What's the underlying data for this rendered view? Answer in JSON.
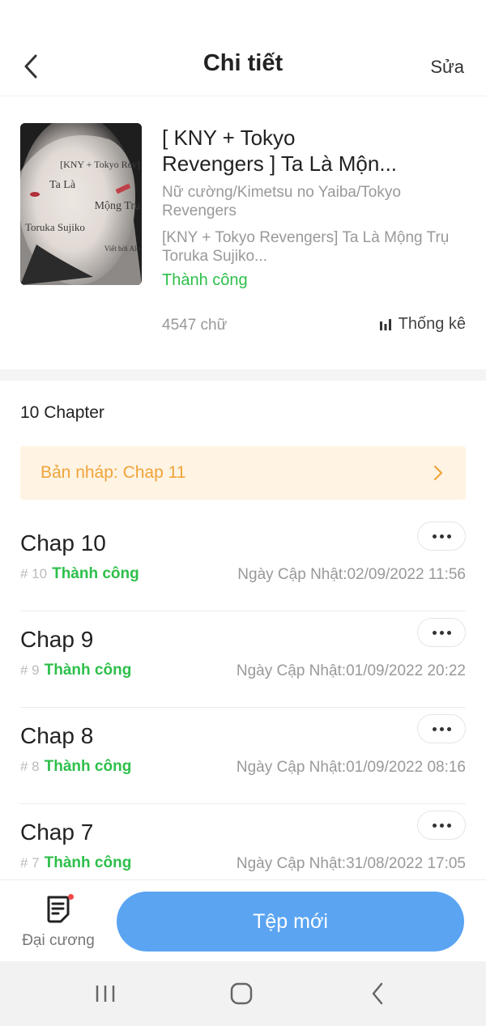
{
  "header": {
    "title": "Chi tiết",
    "edit_label": "Sửa"
  },
  "book": {
    "title_line1": "[ KNY + Tokyo",
    "title_line2": "Revengers ] Ta Là Mộn...",
    "tags": "Nữ cường/Kimetsu no Yaiba/Tokyo Revengers",
    "desc_line1": "[KNY + Tokyo Revengers] Ta Là Mộng Trụ",
    "desc_line2": "Toruka Sujiko...",
    "status": "Thành công",
    "word_count": "4547 chữ",
    "stats_label": "Thống kê",
    "cover_lines": [
      "[KNY + Tokyo Rev]",
      "Ta Là",
      "Mộng Trụ",
      "Toruka Sujiko",
      "Viết bởi Alo"
    ]
  },
  "chapter_section": {
    "count_label": "10 Chapter",
    "draft_label": "Bản nháp: Chap 11"
  },
  "chapters": [
    {
      "title": "Chap 10",
      "num": "# 10",
      "status": "Thành công",
      "date": "Ngày Cập Nhật:02/09/2022 11:56"
    },
    {
      "title": "Chap 9",
      "num": "# 9",
      "status": "Thành công",
      "date": "Ngày Cập Nhật:01/09/2022 20:22"
    },
    {
      "title": "Chap 8",
      "num": "# 8",
      "status": "Thành công",
      "date": "Ngày Cập Nhật:01/09/2022 08:16"
    },
    {
      "title": "Chap 7",
      "num": "# 7",
      "status": "Thành công",
      "date": "Ngày Cập Nhật:31/08/2022 17:05"
    }
  ],
  "bottom_bar": {
    "outline_label": "Đại cương",
    "new_file_label": "Tệp mới"
  },
  "colors": {
    "success": "#2dbf4a",
    "draft_text": "#f0a43a",
    "draft_bg": "#fff3e3",
    "primary_button": "#5aa4f2",
    "notification_dot": "#f04848"
  },
  "icons": {
    "back": "chevron-left-icon",
    "stats": "bar-chart-icon",
    "draft": "chevron-right-icon",
    "more": "ellipsis-icon",
    "outline": "document-list-icon",
    "nav_recent": "recent-apps-icon",
    "nav_home": "home-icon",
    "nav_back": "back-icon"
  }
}
